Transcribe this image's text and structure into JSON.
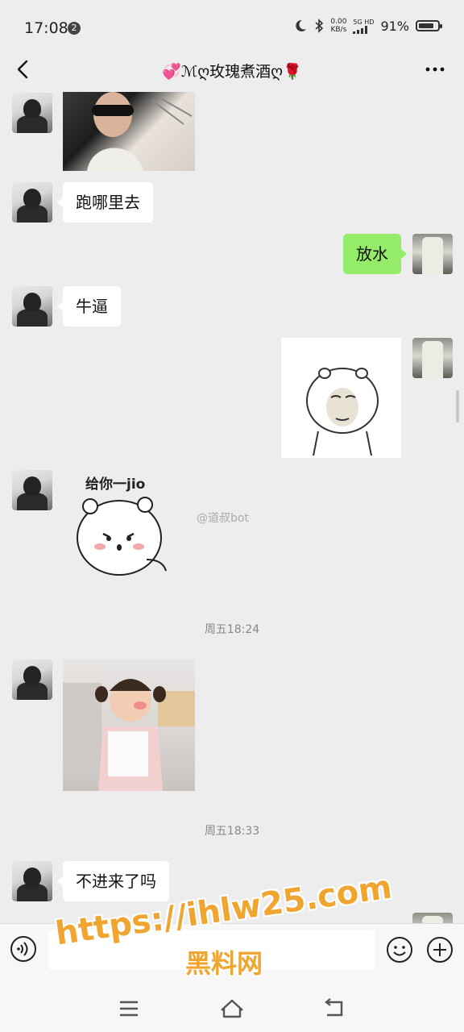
{
  "status_bar": {
    "time": "17:08",
    "notification_count": "2",
    "net_speed_value": "0.00",
    "net_speed_unit": "KB/s",
    "network": "5G HD",
    "battery_percent": "91%"
  },
  "header": {
    "title": "💞ℳღ玫瑰煮酒ღ🌹"
  },
  "messages": [
    {
      "side": "left",
      "type": "image"
    },
    {
      "side": "left",
      "type": "text",
      "text": "跑哪里去"
    },
    {
      "side": "right",
      "type": "text",
      "text": "放水"
    },
    {
      "side": "left",
      "type": "text",
      "text": "牛逼"
    },
    {
      "side": "right",
      "type": "sticker"
    },
    {
      "side": "left",
      "type": "sticker",
      "caption": "给你一jio"
    },
    {
      "type": "timestamp",
      "text": "周五18:24"
    },
    {
      "side": "left",
      "type": "image"
    },
    {
      "type": "timestamp",
      "text": "周五18:33"
    },
    {
      "side": "left",
      "type": "text",
      "text": "不进来了吗"
    }
  ],
  "weibo_watermark": "@道叔bot",
  "watermark": {
    "url": "https://ihlw25.com",
    "name": "黑料网"
  },
  "colors": {
    "background": "#ededed",
    "self_bubble": "#95ec69",
    "other_bubble": "#ffffff",
    "watermark": "#f0a531"
  },
  "icons": {
    "back": "chevron-left-icon",
    "more": "more-dots-icon",
    "voice": "voice-icon",
    "emoji": "smile-icon",
    "plus": "plus-icon",
    "home": "home-icon",
    "menu": "menu-icon",
    "return": "return-icon"
  }
}
